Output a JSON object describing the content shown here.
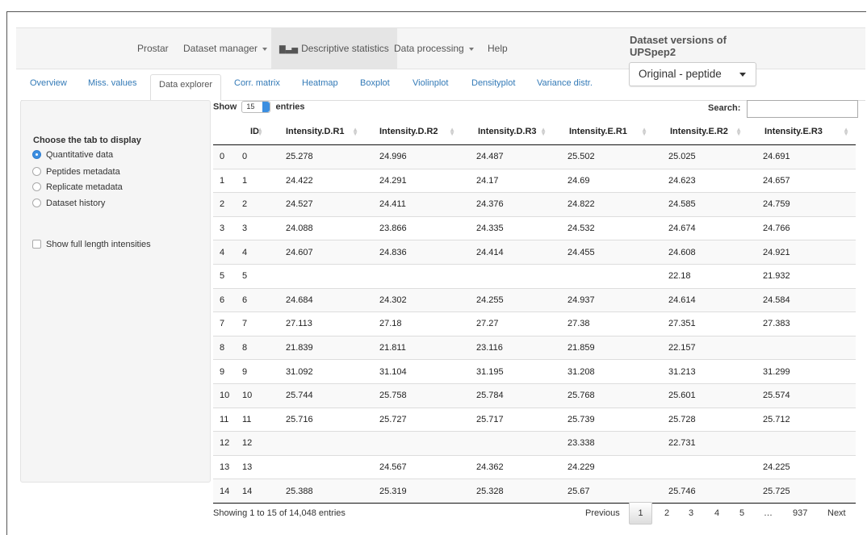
{
  "navbar": {
    "brand": "Prostar",
    "items": [
      {
        "label": "Dataset manager",
        "dropdown": true
      },
      {
        "label": "Descriptive statistics",
        "active": true,
        "icon": "bar-chart-icon"
      },
      {
        "label": "Data processing",
        "dropdown": true
      },
      {
        "label": "Help"
      }
    ],
    "dataset_versions_title": "Dataset versions of UPSpep2",
    "version_selected": "Original - peptide"
  },
  "tabs": [
    "Overview",
    "Miss. values",
    "Data explorer",
    "Corr. matrix",
    "Heatmap",
    "Boxplot",
    "Violinplot",
    "Densityplot",
    "Variance distr."
  ],
  "active_tab": "Data explorer",
  "sidebar": {
    "title": "Choose the tab to display",
    "options": [
      "Quantitative data",
      "Peptides metadata",
      "Replicate metadata",
      "Dataset history"
    ],
    "selected": "Quantitative data",
    "checkbox_label": "Show full length intensities"
  },
  "table_controls": {
    "show_label": "Show",
    "page_length": "15",
    "entries_label": "entries",
    "search_label": "Search:",
    "search_value": ""
  },
  "table": {
    "columns": [
      "",
      "ID",
      "Intensity.D.R1",
      "Intensity.D.R2",
      "Intensity.D.R3",
      "Intensity.E.R1",
      "Intensity.E.R2",
      "Intensity.E.R3"
    ],
    "rows": [
      [
        "0",
        "0",
        "25.278",
        "24.996",
        "24.487",
        "25.502",
        "25.025",
        "24.691"
      ],
      [
        "1",
        "1",
        "24.422",
        "24.291",
        "24.17",
        "24.69",
        "24.623",
        "24.657"
      ],
      [
        "2",
        "2",
        "24.527",
        "24.411",
        "24.376",
        "24.822",
        "24.585",
        "24.759"
      ],
      [
        "3",
        "3",
        "24.088",
        "23.866",
        "24.335",
        "24.532",
        "24.674",
        "24.766"
      ],
      [
        "4",
        "4",
        "24.607",
        "24.836",
        "24.414",
        "24.455",
        "24.608",
        "24.921"
      ],
      [
        "5",
        "5",
        "",
        "",
        "",
        "",
        "22.18",
        "21.932"
      ],
      [
        "6",
        "6",
        "24.684",
        "24.302",
        "24.255",
        "24.937",
        "24.614",
        "24.584"
      ],
      [
        "7",
        "7",
        "27.113",
        "27.18",
        "27.27",
        "27.38",
        "27.351",
        "27.383"
      ],
      [
        "8",
        "8",
        "21.839",
        "21.811",
        "23.116",
        "21.859",
        "22.157",
        ""
      ],
      [
        "9",
        "9",
        "31.092",
        "31.104",
        "31.195",
        "31.208",
        "31.213",
        "31.299"
      ],
      [
        "10",
        "10",
        "25.744",
        "25.758",
        "25.784",
        "25.768",
        "25.601",
        "25.574"
      ],
      [
        "11",
        "11",
        "25.716",
        "25.727",
        "25.717",
        "25.739",
        "25.728",
        "25.712"
      ],
      [
        "12",
        "12",
        "",
        "",
        "",
        "23.338",
        "22.731",
        ""
      ],
      [
        "13",
        "13",
        "",
        "24.567",
        "24.362",
        "24.229",
        "",
        "24.225"
      ],
      [
        "14",
        "14",
        "25.388",
        "25.319",
        "25.328",
        "25.67",
        "25.746",
        "25.725"
      ]
    ]
  },
  "footer": {
    "info": "Showing 1 to 15 of 14,048 entries",
    "previous": "Previous",
    "pages": [
      "1",
      "2",
      "3",
      "4",
      "5",
      "…",
      "937"
    ],
    "current_page": "1",
    "next": "Next"
  }
}
